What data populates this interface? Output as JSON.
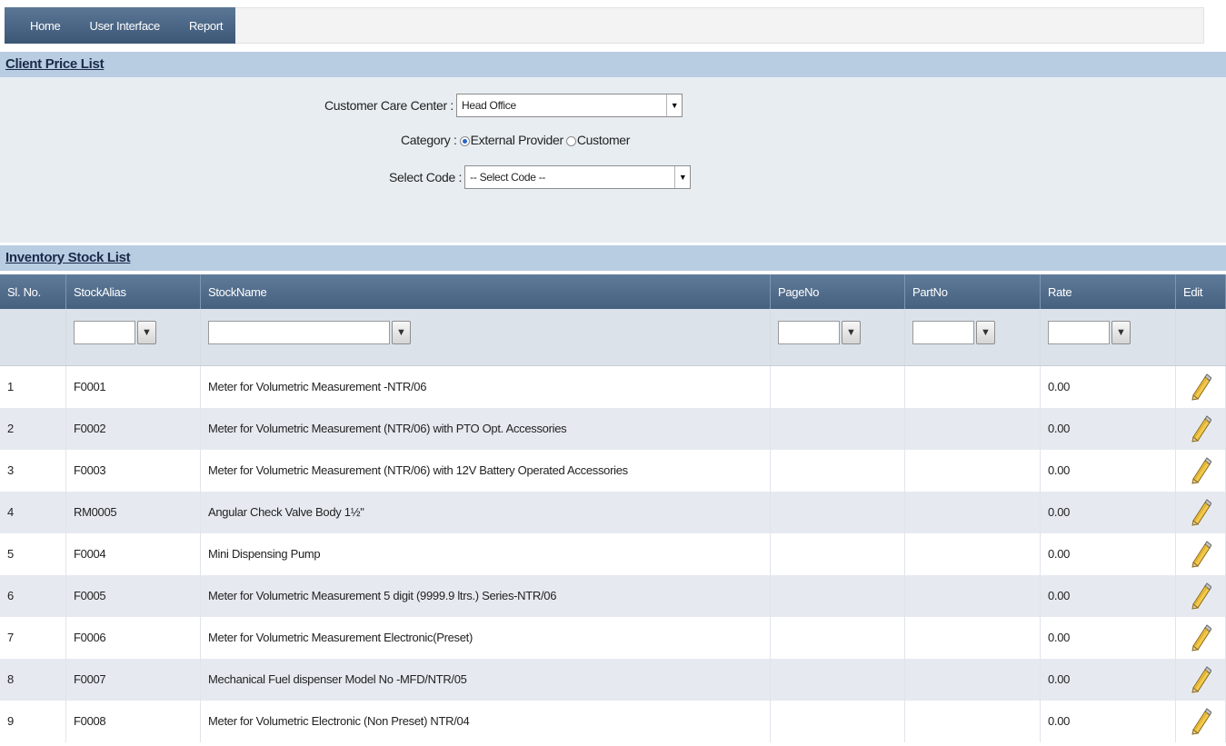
{
  "nav": {
    "items": [
      "Home",
      "User Interface",
      "Report"
    ]
  },
  "client_section": {
    "title": "Client Price List"
  },
  "form": {
    "care_center": {
      "label": "Customer Care Center :",
      "value": "Head Office"
    },
    "category": {
      "label": "Category :",
      "options": [
        "External Provider",
        "Customer"
      ],
      "selected": "External Provider"
    },
    "code": {
      "label": "Select Code :",
      "value": "-- Select Code --"
    }
  },
  "inventory_section": {
    "title": "Inventory Stock List"
  },
  "grid": {
    "columns": [
      "Sl. No.",
      "StockAlias",
      "StockName",
      "PageNo",
      "PartNo",
      "Rate",
      "Edit"
    ],
    "rows": [
      [
        "1",
        "F0001",
        "Meter for Volumetric Measurement -NTR/06",
        "",
        "",
        "0.00"
      ],
      [
        "2",
        "F0002",
        "Meter for Volumetric Measurement (NTR/06) with PTO Opt. Accessories",
        "",
        "",
        "0.00"
      ],
      [
        "3",
        "F0003",
        "Meter for Volumetric Measurement (NTR/06) with 12V Battery Operated Accessories",
        "",
        "",
        "0.00"
      ],
      [
        "4",
        "RM0005",
        "Angular Check Valve Body 1½\"",
        "",
        "",
        "0.00"
      ],
      [
        "5",
        "F0004",
        "Mini Dispensing Pump",
        "",
        "",
        "0.00"
      ],
      [
        "6",
        "F0005",
        "Meter for Volumetric Measurement 5 digit (9999.9 ltrs.) Series-NTR/06",
        "",
        "",
        "0.00"
      ],
      [
        "7",
        "F0006",
        "Meter for Volumetric Measurement Electronic(Preset)",
        "",
        "",
        "0.00"
      ],
      [
        "8",
        "F0007",
        "Mechanical Fuel dispenser Model No -MFD/NTR/05",
        "",
        "",
        "0.00"
      ],
      [
        "9",
        "F0008",
        "Meter for Volumetric Electronic (Non Preset) NTR/04",
        "",
        "",
        "0.00"
      ]
    ]
  },
  "icons": {
    "filter": "filter-icon",
    "edit": "pencil-icon",
    "dropdown": "chevron-down-icon"
  },
  "colors": {
    "nav": "#46607f",
    "section_header": "#b9cde2",
    "grid_header": "#526d8d",
    "row_alt": "#e6eaf0"
  }
}
